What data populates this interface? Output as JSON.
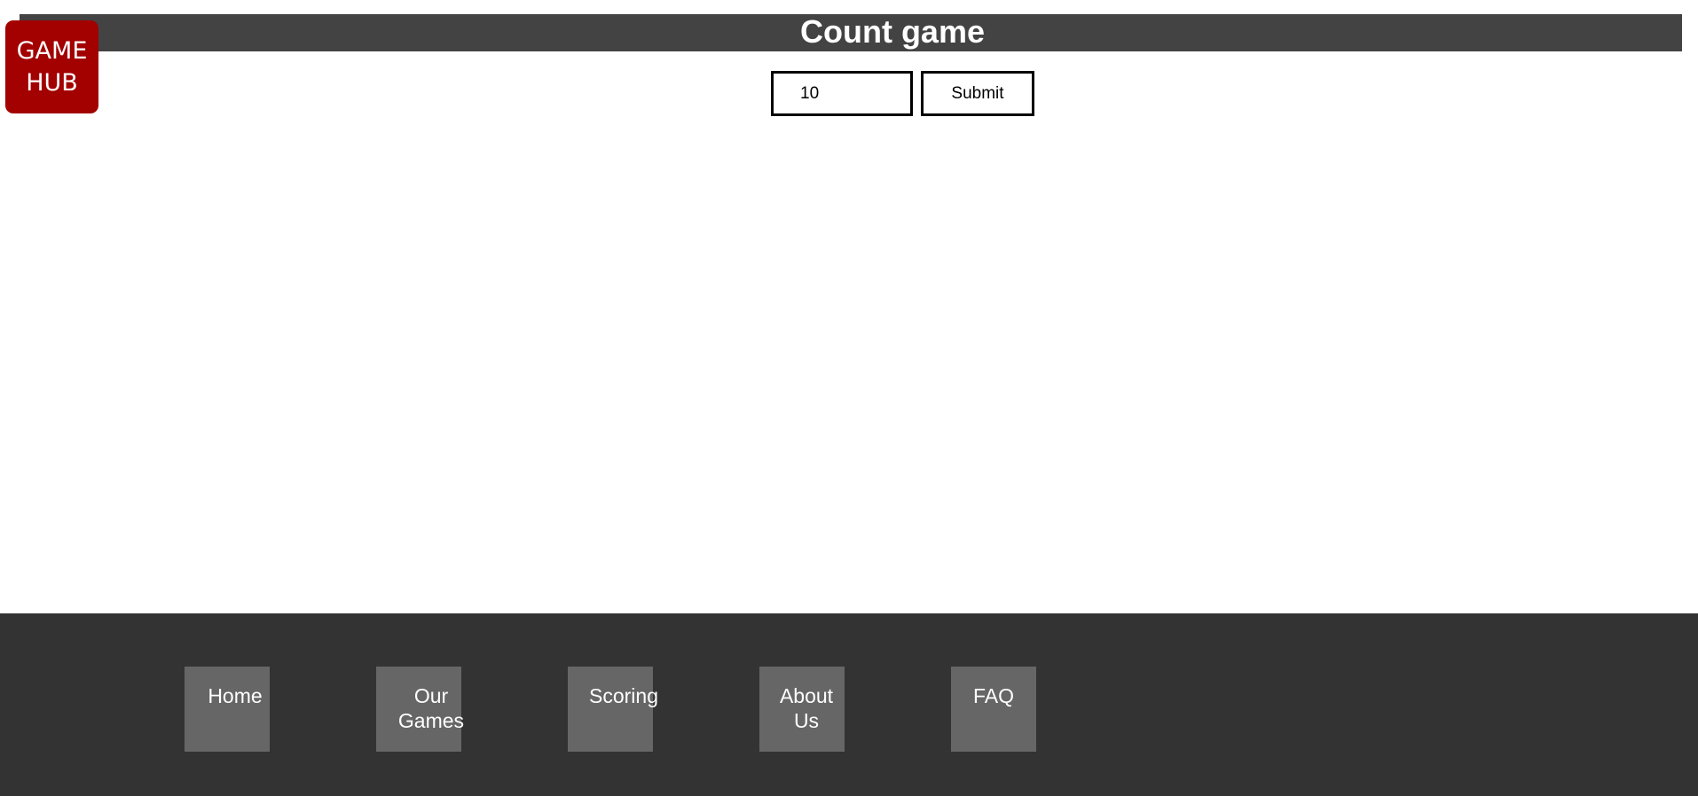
{
  "header": {
    "title": "Count game",
    "bar_color": "#434343"
  },
  "logo": {
    "line1": "GAME",
    "line2": "HUB",
    "color": "#a30000"
  },
  "form": {
    "input_value": "10",
    "submit_label": "Submit"
  },
  "footer": {
    "background": "#333333",
    "nav": [
      {
        "label": "Home"
      },
      {
        "label": "Our\nGames"
      },
      {
        "label": "Scoring"
      },
      {
        "label": "About\nUs"
      },
      {
        "label": "FAQ"
      }
    ]
  }
}
